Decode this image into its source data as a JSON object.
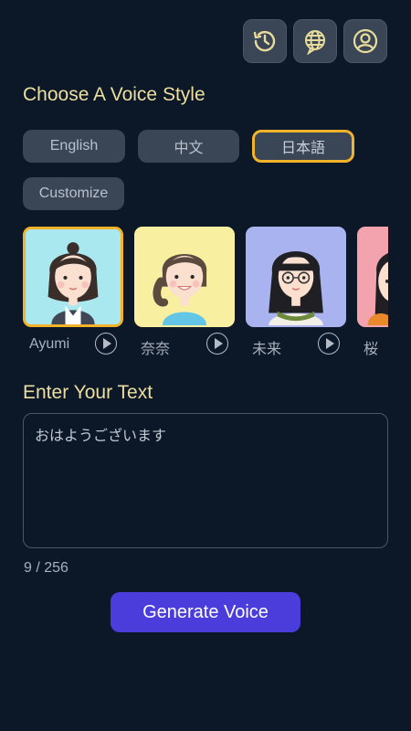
{
  "header": {
    "icons": [
      "history-icon",
      "globe-chat-icon",
      "user-profile-icon"
    ]
  },
  "voice_style": {
    "title": "Choose A Voice Style",
    "languages": [
      {
        "label": "English",
        "active": false
      },
      {
        "label": "中文",
        "active": false
      },
      {
        "label": "日本語",
        "active": true
      }
    ],
    "customize_label": "Customize"
  },
  "voices": [
    {
      "name": "Ayumi",
      "bg": "#a8e8ee",
      "active": true
    },
    {
      "name": "奈奈",
      "bg": "#f8f0a0",
      "active": false
    },
    {
      "name": "未来",
      "bg": "#a9b3f0",
      "active": false
    },
    {
      "name": "桜",
      "bg": "#f2a3ae",
      "active": false
    }
  ],
  "text_input": {
    "title": "Enter Your Text",
    "value": "おはようございます",
    "counter": "9 / 256"
  },
  "generate_label": "Generate Voice",
  "colors": {
    "background": "#0c1728",
    "accent_yellow": "#f2b32b",
    "title_color": "#ecdf9f",
    "button_primary": "#4a3ddb",
    "chip_bg": "#3a4556"
  }
}
